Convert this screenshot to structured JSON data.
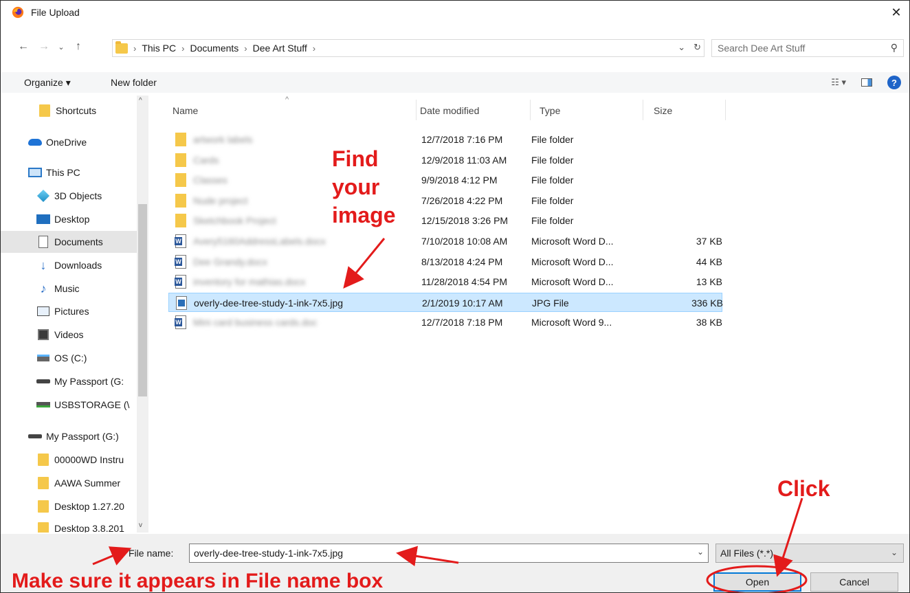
{
  "window": {
    "title": "File Upload",
    "close_glyph": "✕"
  },
  "address": {
    "crumbs": [
      "This PC",
      "Documents",
      "Dee Art Stuff"
    ],
    "search_placeholder": "Search Dee Art Stuff"
  },
  "toolbar": {
    "organize_label": "Organize ▾",
    "new_folder_label": "New folder"
  },
  "nav": {
    "items": [
      {
        "label": "Shortcuts",
        "icon": "folder-icon"
      },
      {
        "label": "OneDrive",
        "icon": "onedrive-icon"
      },
      {
        "label": "This PC",
        "icon": "this-pc-icon"
      },
      {
        "label": "3D Objects",
        "icon": "3d-objects-icon"
      },
      {
        "label": "Desktop",
        "icon": "desktop-icon"
      },
      {
        "label": "Documents",
        "icon": "documents-icon"
      },
      {
        "label": "Downloads",
        "icon": "downloads-icon"
      },
      {
        "label": "Music",
        "icon": "music-icon"
      },
      {
        "label": "Pictures",
        "icon": "pictures-icon"
      },
      {
        "label": "Videos",
        "icon": "videos-icon"
      },
      {
        "label": "OS (C:)",
        "icon": "os-drive-icon"
      },
      {
        "label": "My Passport (G:",
        "icon": "drive-icon"
      },
      {
        "label": "USBSTORAGE (\\",
        "icon": "usb-icon"
      },
      {
        "label": "My Passport (G:)",
        "icon": "drive-icon"
      },
      {
        "label": "00000WD Instru",
        "icon": "folder-icon"
      },
      {
        "label": "AAWA Summer",
        "icon": "folder-icon"
      },
      {
        "label": "Desktop 1.27.20",
        "icon": "folder-icon"
      },
      {
        "label": "Desktop 3.8.201",
        "icon": "folder-icon"
      }
    ]
  },
  "columns": {
    "name": "Name",
    "date": "Date modified",
    "type": "Type",
    "size": "Size"
  },
  "files": [
    {
      "name": "artwork labels",
      "date": "12/7/2018 7:16 PM",
      "type": "File folder",
      "size": "",
      "kind": "folder",
      "blurred": true
    },
    {
      "name": "Cards",
      "date": "12/9/2018 11:03 AM",
      "type": "File folder",
      "size": "",
      "kind": "folder",
      "blurred": true
    },
    {
      "name": "Classes",
      "date": "9/9/2018 4:12 PM",
      "type": "File folder",
      "size": "",
      "kind": "folder",
      "blurred": true
    },
    {
      "name": "Nude project",
      "date": "7/26/2018 4:22 PM",
      "type": "File folder",
      "size": "",
      "kind": "folder",
      "blurred": true
    },
    {
      "name": "Sketchbook Project",
      "date": "12/15/2018 3:26 PM",
      "type": "File folder",
      "size": "",
      "kind": "folder",
      "blurred": true
    },
    {
      "name": "Avery5160AddressLabels.docx",
      "date": "7/10/2018 10:08 AM",
      "type": "Microsoft Word D...",
      "size": "37 KB",
      "kind": "word",
      "blurred": true
    },
    {
      "name": "Dee Grandy.docx",
      "date": "8/13/2018 4:24 PM",
      "type": "Microsoft Word D...",
      "size": "44 KB",
      "kind": "word",
      "blurred": true
    },
    {
      "name": "inventory for mathias.docx",
      "date": "11/28/2018 4:54 PM",
      "type": "Microsoft Word D...",
      "size": "13 KB",
      "kind": "word",
      "blurred": true
    },
    {
      "name": "overly-dee-tree-study-1-ink-7x5.jpg",
      "date": "2/1/2019 10:17 AM",
      "type": "JPG File",
      "size": "336 KB",
      "kind": "jpg",
      "blurred": false,
      "selected": true
    },
    {
      "name": "Mini card business cards.doc",
      "date": "12/7/2018 7:18 PM",
      "type": "Microsoft Word 9...",
      "size": "38 KB",
      "kind": "word",
      "blurred": true
    }
  ],
  "bottom": {
    "file_name_label": "File name:",
    "file_name_value": "overly-dee-tree-study-1-ink-7x5.jpg",
    "filter_value": "All Files (*.*)",
    "open_label": "Open",
    "cancel_label": "Cancel"
  },
  "annotations": {
    "find_line1": "Find",
    "find_line2": "your",
    "find_line3": "image",
    "click": "Click",
    "make_sure": "Make sure it appears in File name box"
  },
  "colors": {
    "annotation_red": "#e31b1b",
    "selection_blue": "#cce8ff",
    "accent_blue": "#0078d7"
  }
}
